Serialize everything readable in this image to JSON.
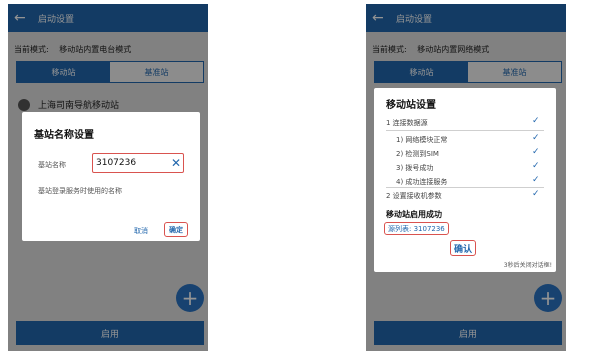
{
  "left_screen": {
    "app_bar": {
      "back_icon": "arrow-left-icon",
      "title": "启动设置"
    },
    "mode": {
      "label": "当前模式:",
      "value": "移动站内置电台模式"
    },
    "tabs": [
      {
        "label": "移动站",
        "active": true
      },
      {
        "label": "基准站",
        "active": false
      }
    ],
    "station_item": {
      "label": "上海司南导航移动站"
    },
    "dialog": {
      "title": "基站名称设置",
      "field_label": "基站名称",
      "field_value": "3107236",
      "clear_icon": "close-icon",
      "hint": "基站登录服务时使用的名称",
      "cancel_label": "取消",
      "ok_label": "确定"
    },
    "fab_icon": "plus-icon",
    "bottom_button": "启用"
  },
  "right_screen": {
    "app_bar": {
      "back_icon": "arrow-left-icon",
      "title": "启动设置"
    },
    "mode": {
      "label": "当前模式:",
      "value": "移动站内置网络模式"
    },
    "tabs": [
      {
        "label": "移动站",
        "active": true
      },
      {
        "label": "基准站",
        "active": false
      }
    ],
    "dialog": {
      "title": "移动站设置",
      "step1": "1  连接数据源",
      "substeps": [
        "1)  网络模块正常",
        "2)  检测到SIM",
        "3)  拨号成功",
        "4)  成功连接服务"
      ],
      "step2": "2  设置接收机参数",
      "success": "移动站启用成功",
      "source_table": "源列表: 3107236",
      "confirm_label": "确认",
      "auto_close": "3秒后关闭对话框!",
      "check_icon": "check-icon"
    },
    "fab_icon": "plus-icon",
    "bottom_button": "启用"
  },
  "colors": {
    "primary": "#2267ad",
    "highlight": "#d9534f",
    "dim": "#dedede"
  }
}
